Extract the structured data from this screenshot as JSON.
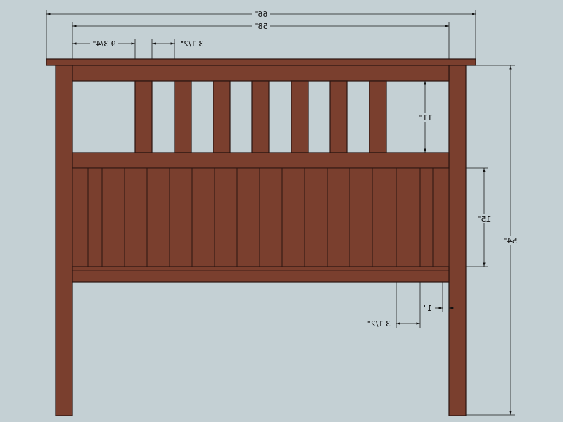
{
  "dimensions": {
    "overall_width": "66\"",
    "inner_width": "58\"",
    "slat_gap": "9 3/4\"",
    "slat_width": "3 1/2\"",
    "upper_opening": "11\"",
    "panel_height": "15\"",
    "overall_height": "54\"",
    "board_width": "3 1/2\"",
    "inset": "1\""
  },
  "colors": {
    "wood": "#7a3f2e",
    "outline": "#2a1410",
    "background": "#c4d0d4"
  },
  "view": "mirrored"
}
